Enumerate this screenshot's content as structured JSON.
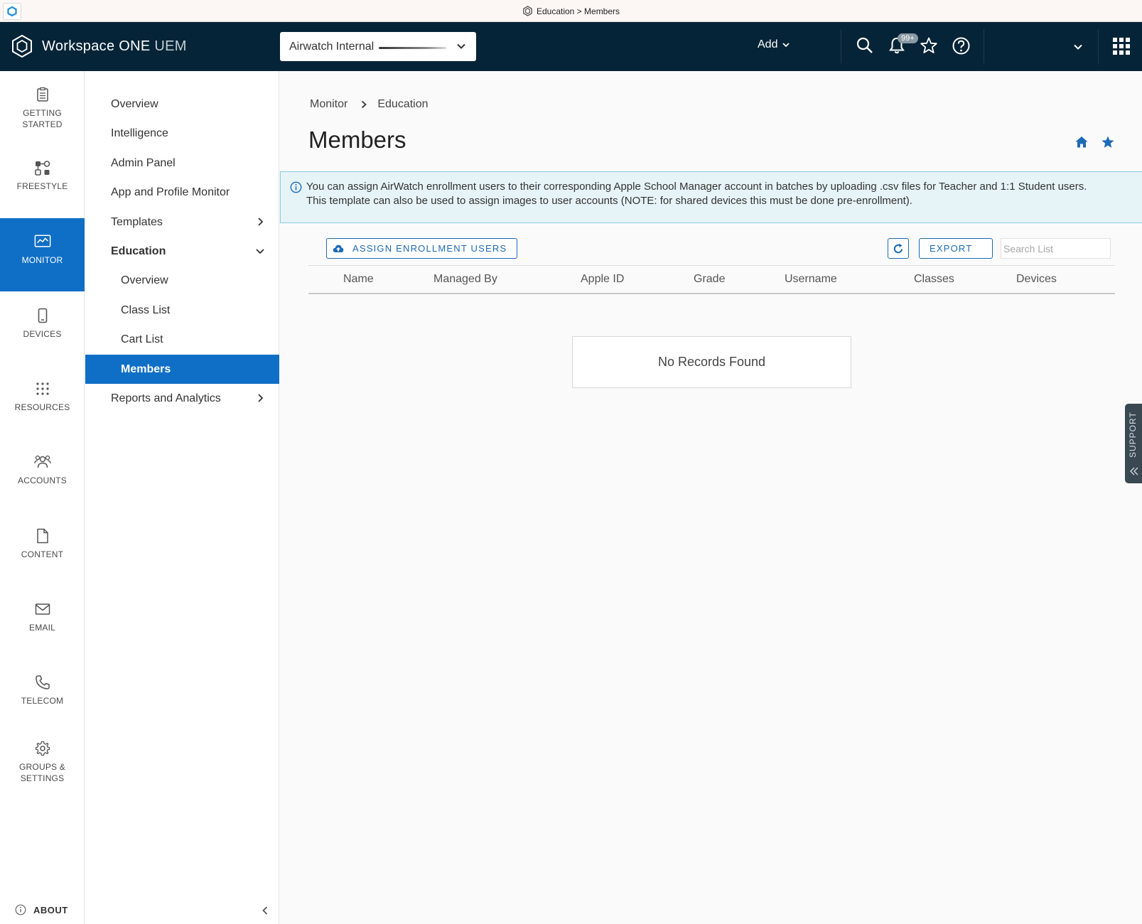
{
  "window": {
    "title": "Education > Members"
  },
  "header": {
    "product_name": "Workspace ONE",
    "product_suffix": "UEM",
    "org_selector_value": "Airwatch Internal",
    "add_label": "Add",
    "notification_badge": "99+"
  },
  "rail": {
    "items": [
      {
        "label": "GETTING STARTED",
        "icon": "clipboard-icon"
      },
      {
        "label": "FREESTYLE",
        "icon": "freestyle-icon"
      },
      {
        "label": "MONITOR",
        "icon": "monitor-chart-icon",
        "active": true
      },
      {
        "label": "DEVICES",
        "icon": "phone-icon"
      },
      {
        "label": "RESOURCES",
        "icon": "grid-dots-icon"
      },
      {
        "label": "ACCOUNTS",
        "icon": "users-icon"
      },
      {
        "label": "CONTENT",
        "icon": "document-icon"
      },
      {
        "label": "EMAIL",
        "icon": "envelope-icon"
      },
      {
        "label": "TELECOM",
        "icon": "telephone-icon"
      },
      {
        "label": "GROUPS & SETTINGS",
        "icon": "gear-icon"
      }
    ],
    "about_label": "ABOUT"
  },
  "subnav": {
    "items": [
      {
        "label": "Overview"
      },
      {
        "label": "Intelligence"
      },
      {
        "label": "Admin Panel"
      },
      {
        "label": "App and Profile Monitor"
      },
      {
        "label": "Templates"
      },
      {
        "label": "Education"
      },
      {
        "label": "Overview"
      },
      {
        "label": "Class List"
      },
      {
        "label": "Cart List"
      },
      {
        "label": "Members",
        "active": true
      },
      {
        "label": "Reports and Analytics"
      }
    ]
  },
  "main": {
    "breadcrumb": [
      "Monitor",
      "Education"
    ],
    "title": "Members",
    "info_line1": "You can assign AirWatch enrollment users to their corresponding Apple School Manager account in batches by uploading .csv files for Teacher and 1:1 Student users.",
    "info_line2": "This template can also be used to assign images to user accounts (NOTE: for shared devices this must be done pre-enrollment).",
    "assign_label": "ASSIGN ENROLLMENT USERS",
    "export_label": "EXPORT",
    "search_placeholder": "Search List",
    "columns": [
      "Name",
      "Managed By",
      "Apple ID",
      "Grade",
      "Username",
      "Classes",
      "Devices"
    ],
    "empty_message": "No Records Found",
    "support_label": "SUPPORT"
  },
  "colors": {
    "header_bg": "#062437",
    "accent": "#0f6fc6",
    "banner_bg": "#e6f3f7"
  }
}
